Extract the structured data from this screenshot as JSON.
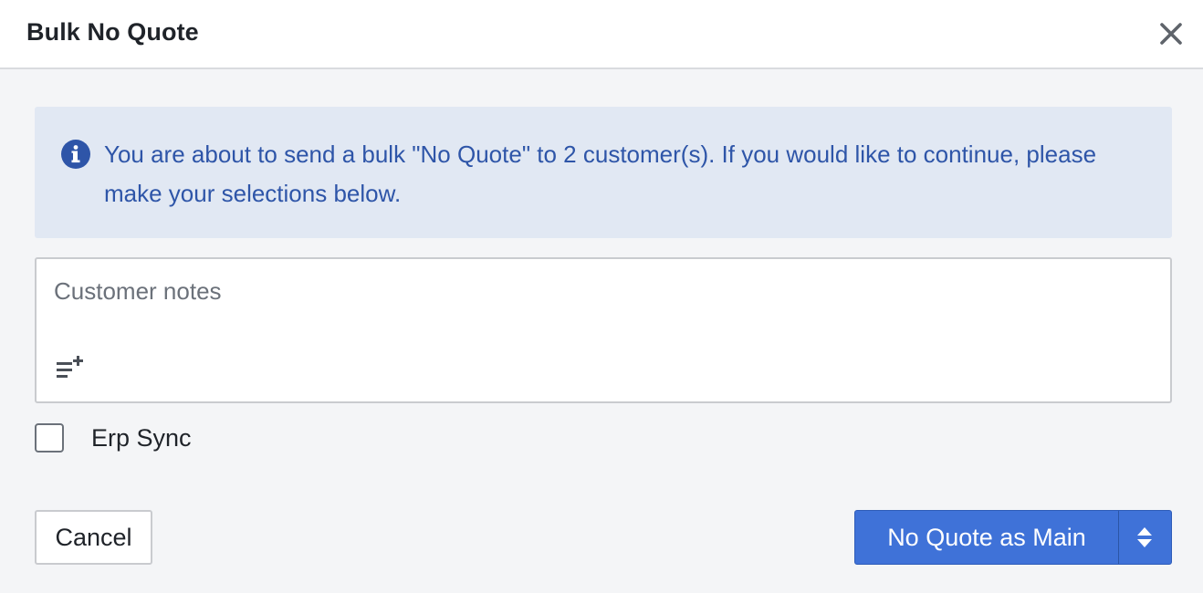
{
  "header": {
    "title": "Bulk No Quote",
    "close_icon": "close-icon"
  },
  "info": {
    "icon": "info-icon",
    "message": "You are about to send a bulk \"No Quote\" to 2 customer(s). If you would like to continue, please make your selections below."
  },
  "notes": {
    "placeholder": "Customer notes",
    "add_icon": "list-add-icon"
  },
  "erp_sync": {
    "label": "Erp Sync",
    "checked": false
  },
  "actions": {
    "cancel_label": "Cancel",
    "primary_label": "No Quote as Main",
    "toggle_icon": "sort-arrows-icon"
  },
  "colors": {
    "primary": "#3f72d8",
    "info_bg": "#e1e8f3",
    "info_text": "#2e55a8"
  }
}
